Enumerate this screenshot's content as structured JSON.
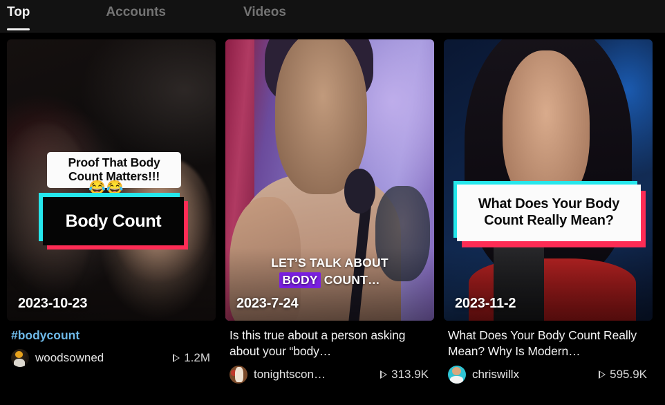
{
  "tabs": [
    {
      "label": "Top",
      "active": true
    },
    {
      "label": "Accounts",
      "active": false
    },
    {
      "label": "Videos",
      "active": false
    }
  ],
  "cards": [
    {
      "overlay_caption": "Proof That Body Count Matters!!!",
      "overlay_emoji": "😂😂",
      "overlay_sticker": "Body Count",
      "date": "2023-10-23",
      "hashtag": "#bodycount",
      "username": "woodsowned",
      "plays": "1.2M",
      "avatar_icon": "avatar-woodsowned"
    },
    {
      "overlay_line1": "LET’S TALK ABOUT",
      "overlay_highlight": "BODY",
      "overlay_line2_rest": "COUNT…",
      "highlight_color": "#7a1fe0",
      "date": "2023-7-24",
      "caption": "Is this true about a person asking about your “body…",
      "username": "tonightscon…",
      "plays": "313.9K",
      "avatar_icon": "avatar-tonightscon"
    },
    {
      "overlay_sticker": "What Does Your Body Count Really Mean?",
      "date": "2023-11-2",
      "caption": "What Does Your Body Count Really Mean? Why Is Modern…",
      "username": "chriswillx",
      "plays": "595.9K",
      "avatar_icon": "avatar-chriswillx"
    }
  ],
  "colors": {
    "background": "#000000",
    "tabbar_bg": "#121212",
    "tab_active": "#f2f2f2",
    "tab_inactive": "#737373",
    "hashtag_link": "#6eb9e8",
    "tiktok_cyan": "#25e7ec",
    "tiktok_red": "#fe2c55",
    "caption_text": "#f2f2f2"
  },
  "icons": {
    "play": "play-icon"
  }
}
